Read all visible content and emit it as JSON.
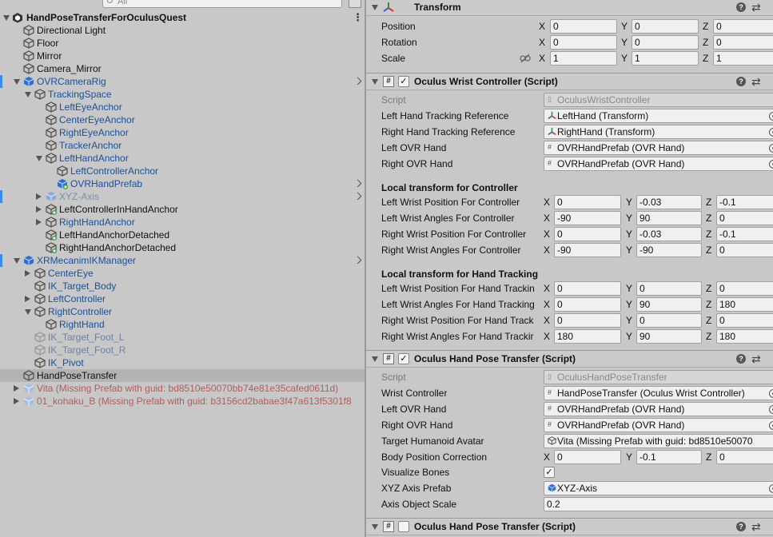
{
  "hierarchy": {
    "search_placeholder": "All",
    "scene": "HandPoseTransferForOculusQuest",
    "items": [
      {
        "label": "Directional Light"
      },
      {
        "label": "Floor"
      },
      {
        "label": "Mirror"
      },
      {
        "label": "Camera_Mirror"
      },
      {
        "label": "OVRCameraRig"
      },
      {
        "label": "TrackingSpace"
      },
      {
        "label": "LeftEyeAnchor"
      },
      {
        "label": "CenterEyeAnchor"
      },
      {
        "label": "RightEyeAnchor"
      },
      {
        "label": "TrackerAnchor"
      },
      {
        "label": "LeftHandAnchor"
      },
      {
        "label": "LeftControllerAnchor"
      },
      {
        "label": "OVRHandPrefab"
      },
      {
        "label": "XYZ-Axis"
      },
      {
        "label": "LeftControllerInHandAnchor"
      },
      {
        "label": "RightHandAnchor"
      },
      {
        "label": "LeftHandAnchorDetached"
      },
      {
        "label": "RightHandAnchorDetached"
      },
      {
        "label": "XRMecanimIKManager"
      },
      {
        "label": "CenterEye"
      },
      {
        "label": "IK_Target_Body"
      },
      {
        "label": "LeftController"
      },
      {
        "label": "RightController"
      },
      {
        "label": "RightHand"
      },
      {
        "label": "IK_Target_Foot_L"
      },
      {
        "label": "IK_Target_Foot_R"
      },
      {
        "label": "IK_Pivot"
      },
      {
        "label": "HandPoseTransfer"
      },
      {
        "label": "Vita (Missing Prefab with guid: bd8510e50070bb74e81e35cafed0611d)"
      },
      {
        "label": "01_kohaku_B (Missing Prefab with guid: b3156cd2babae3f47a613f5301f8"
      }
    ]
  },
  "transform": {
    "title": "Transform",
    "position_label": "Position",
    "rotation_label": "Rotation",
    "scale_label": "Scale",
    "position": {
      "x": "0",
      "y": "0",
      "z": "0"
    },
    "rotation": {
      "x": "0",
      "y": "0",
      "z": "0"
    },
    "scale": {
      "x": "1",
      "y": "1",
      "z": "1"
    }
  },
  "axes": {
    "x": "X",
    "y": "Y",
    "z": "Z"
  },
  "wrist": {
    "title": "Oculus Wrist Controller (Script)",
    "script_label": "Script",
    "script_value": "OculusWristController",
    "left_ref_label": "Left Hand Tracking Reference",
    "left_ref_value": "LeftHand (Transform)",
    "right_ref_label": "Right Hand Tracking Reference",
    "right_ref_value": "RightHand (Transform)",
    "left_ovr_label": "Left OVR Hand",
    "left_ovr_value": "OVRHandPrefab (OVR Hand)",
    "right_ovr_label": "Right OVR Hand",
    "right_ovr_value": "OVRHandPrefab (OVR Hand)",
    "section_controller": "Local transform for Controller",
    "section_hand": "Local transform for Hand Tracking",
    "rows": [
      {
        "label": "Left Wrist Position For Controller",
        "x": "0",
        "y": "-0.03",
        "z": "-0.1"
      },
      {
        "label": "Left Wrist Angles For Controller",
        "x": "-90",
        "y": "90",
        "z": "0"
      },
      {
        "label": "Right Wrist Position For Controller",
        "x": "0",
        "y": "-0.03",
        "z": "-0.1"
      },
      {
        "label": "Right Wrist Angles For Controller",
        "x": "-90",
        "y": "-90",
        "z": "0"
      },
      {
        "label": "Left Wrist Position For Hand Trackin",
        "x": "0",
        "y": "0",
        "z": "0"
      },
      {
        "label": "Left Wrist Angles For Hand Tracking",
        "x": "0",
        "y": "90",
        "z": "180"
      },
      {
        "label": "Right Wrist Position For Hand Track",
        "x": "0",
        "y": "0",
        "z": "0"
      },
      {
        "label": "Right Wrist Angles For Hand Trackir",
        "x": "180",
        "y": "90",
        "z": "180"
      }
    ]
  },
  "hpt": {
    "title": "Oculus Hand Pose Transfer (Script)",
    "script_label": "Script",
    "script_value": "OculusHandPoseTransfer",
    "wrist_label": "Wrist Controller",
    "wrist_value": "HandPoseTransfer (Oculus Wrist Controller)",
    "left_ovr_label": "Left OVR Hand",
    "left_ovr_value": "OVRHandPrefab (OVR Hand)",
    "right_ovr_label": "Right OVR Hand",
    "right_ovr_value": "OVRHandPrefab (OVR Hand)",
    "avatar_label": "Target Humanoid Avatar",
    "avatar_value": "Vita (Missing Prefab with guid: bd8510e50070",
    "body_label": "Body Position Correction",
    "body": {
      "x": "0",
      "y": "-0.1",
      "z": "0"
    },
    "bones_label": "Visualize Bones",
    "bones_checked": "✓",
    "axis_prefab_label": "XYZ Axis Prefab",
    "axis_prefab_value": "XYZ-Axis",
    "axis_scale_label": "Axis Object Scale",
    "axis_scale_value": "0.2"
  },
  "hpt2": {
    "title": "Oculus Hand Pose Transfer (Script)"
  },
  "header_checkmark": "✓",
  "script_glyph": "#",
  "help_glyph": "?",
  "sliders_glyph": "⇄",
  "more_glyph": "⋮",
  "colors": {
    "prefab_blue": "#1b4f9c",
    "missing_red": "#b15d5d",
    "selection": "#b3b3b3",
    "accent": "#3a8ae8"
  }
}
